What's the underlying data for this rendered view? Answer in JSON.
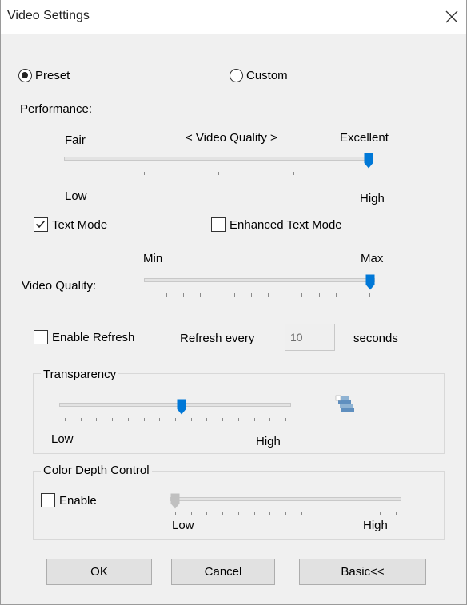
{
  "window": {
    "title": "Video Settings"
  },
  "mode": {
    "preset_label": "Preset",
    "custom_label": "Custom",
    "selected": "Preset"
  },
  "performance": {
    "heading": "Performance:",
    "left_label": "Fair",
    "center_label": "< Video Quality >",
    "right_label": "Excellent",
    "low_label": "Low",
    "high_label": "High",
    "level": 1.0
  },
  "text_mode": {
    "label": "Text Mode",
    "checked": true
  },
  "enhanced_text_mode": {
    "label": "Enhanced Text Mode",
    "checked": false
  },
  "video_quality": {
    "label": "Video Quality:",
    "min_label": "Min",
    "max_label": "Max",
    "level": 1.0
  },
  "refresh": {
    "enable_label": "Enable Refresh",
    "enabled": false,
    "every_label": "Refresh every",
    "value": "10",
    "unit_label": "seconds"
  },
  "transparency": {
    "group_label": "Transparency",
    "low_label": "Low",
    "high_label": "High",
    "level": 0.53
  },
  "color_depth": {
    "group_label": "Color Depth Control",
    "enable_label": "Enable",
    "enabled": false,
    "low_label": "Low",
    "high_label": "High",
    "level": 0.0
  },
  "buttons": {
    "ok": "OK",
    "cancel": "Cancel",
    "basic": "Basic<<"
  },
  "colors": {
    "accent": "#0078d7",
    "disabled_thumb": "#c0c0c0"
  }
}
